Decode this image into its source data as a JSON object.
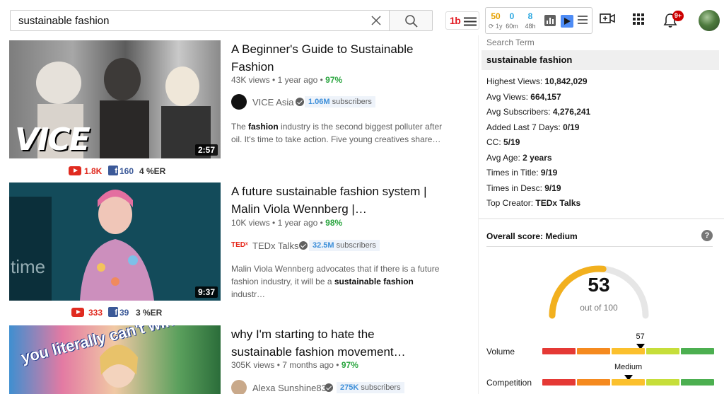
{
  "search": {
    "query": "sustainable fashion"
  },
  "toolbar": {
    "logo_text": "1b",
    "stats": [
      {
        "value": "50",
        "label": "1y",
        "color": "#e6a100"
      },
      {
        "value": "0",
        "label": "60m",
        "color": "#2aa7e0"
      },
      {
        "value": "8",
        "label": "48h",
        "color": "#2aa7e0"
      }
    ],
    "notification_count": "9+"
  },
  "results": [
    {
      "title": "A Beginner's Guide to Sustainable Fashion",
      "views": "43K views",
      "age": "1 year ago",
      "score_pct": "97%",
      "channel": "VICE Asia",
      "subs_count": "1.06M",
      "subs_label": "subscribers",
      "desc_pre": "The ",
      "desc_bold": "fashion",
      "desc_post": " industry is the second biggest polluter after oil. It's time to take action. Five young creatives share…",
      "duration": "2:57",
      "yt": "1.8K",
      "fb": "160",
      "er": "4 %ER",
      "thumb_text": "VICE"
    },
    {
      "title": "A future sustainable fashion system | Malin Viola Wennberg |…",
      "views": "10K views",
      "age": "1 year ago",
      "score_pct": "98%",
      "channel": "TEDx Talks",
      "subs_count": "32.5M",
      "subs_label": "subscribers",
      "desc_pre": "Malin Viola Wennberg advocates that if there is a future fashion industry, it will be a ",
      "desc_bold": "sustainable fashion",
      "desc_post": " industr…",
      "duration": "9:37",
      "yt": "333",
      "fb": "39",
      "er": "3 %ER",
      "thumb_text": "time",
      "channel_logo": "TEDˣ"
    },
    {
      "title": "why I'm starting to hate the sustainable fashion movement…",
      "views": "305K views",
      "age": "7 months ago",
      "score_pct": "97%",
      "channel": "Alexa Sunshine83",
      "subs_count": "275K",
      "subs_label": "subscribers",
      "thumb_text": "you literally can't win."
    }
  ],
  "panel": {
    "search_term_label": "Search Term",
    "search_term": "sustainable fashion",
    "stats": [
      {
        "k": "Highest Views:",
        "v": "10,842,029"
      },
      {
        "k": "Avg Views:",
        "v": "664,157"
      },
      {
        "k": "Avg Subscribers:",
        "v": "4,276,241"
      },
      {
        "k": "Added Last 7 Days:",
        "v": "0/19"
      },
      {
        "k": "CC:",
        "v": "5/19"
      },
      {
        "k": "Avg Age:",
        "v": "2 years"
      },
      {
        "k": "Times in Title:",
        "v": "9/19"
      },
      {
        "k": "Times in Desc:",
        "v": "9/19"
      },
      {
        "k": "Top Creator:",
        "v": "TEDx Talks"
      }
    ],
    "overall_label": "Overall score:",
    "overall_value": "Medium",
    "help": "?",
    "score": "53",
    "score_fraction": 0.53,
    "score_outof": "out of 100",
    "volume_label": "Volume",
    "volume_value": "57",
    "volume_level": 0.57,
    "competition_label": "Competition",
    "competition_value": "Medium",
    "competition_level": 0.5,
    "meter_colors": [
      "#e53935",
      "#f58a1f",
      "#fbc02d",
      "#c6de3a",
      "#4caf50"
    ]
  }
}
